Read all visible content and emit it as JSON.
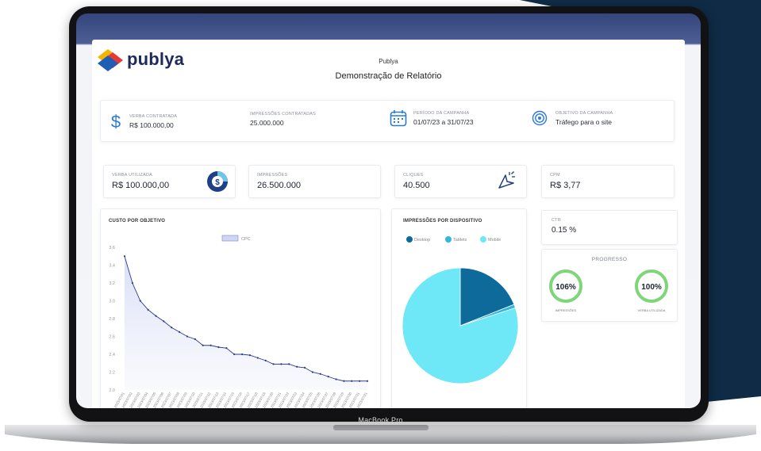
{
  "device": {
    "label": "MacBook Pro"
  },
  "header": {
    "brand": "publya",
    "company": "Publya",
    "report_title": "Demonstração de Relatório"
  },
  "summary": {
    "budget": {
      "label": "VERBA CONTRATADA",
      "value": "R$ 100.000,00",
      "icon": "dollar-icon"
    },
    "impressions": {
      "label": "IMPRESSÕES CONTRATADAS",
      "value": "25.000.000"
    },
    "period": {
      "label": "PERÍODO DA CAMPANHA",
      "value": "01/07/23 a 31/07/23",
      "icon": "calendar-icon"
    },
    "objective": {
      "label": "OBJETIVO DA CAMPANHA",
      "value": "Tráfego para o site",
      "icon": "target-icon"
    }
  },
  "metrics": {
    "spent": {
      "label": "VERBA UTILIZADA",
      "value": "R$ 100.000,00",
      "icon": "coin-icon"
    },
    "impressions": {
      "label": "IMPRESSÕES",
      "value": "26.500.000"
    },
    "clicks": {
      "label": "CLIQUES",
      "value": "40.500",
      "icon": "cursor-click-icon"
    },
    "cpm": {
      "label": "CPM",
      "value": "R$ 3,77"
    },
    "ctr": {
      "label": "CTR",
      "value": "0.15 %"
    }
  },
  "progress": {
    "title": "PROGRESSO",
    "items": [
      {
        "value": "106%",
        "label": "IMPRESSÕES",
        "fraction": 1.0
      },
      {
        "value": "100%",
        "label": "VERBA UTILIZADA",
        "fraction": 1.0
      }
    ],
    "color": "#7fd67a"
  },
  "colors": {
    "navy": "#0f2b46",
    "desktop": "#0d6a9b",
    "tablets": "#2fb8dd",
    "mobile": "#6ee7f7",
    "line": "#2e3a8c"
  },
  "chart_data": [
    {
      "type": "line",
      "title": "CUSTO POR OBJETIVO",
      "series": [
        {
          "name": "CPC",
          "values": [
            3.5,
            3.2,
            3.0,
            2.9,
            2.83,
            2.77,
            2.7,
            2.65,
            2.6,
            2.57,
            2.5,
            2.5,
            2.48,
            2.47,
            2.4,
            2.4,
            2.39,
            2.36,
            2.33,
            2.29,
            2.29,
            2.29,
            2.26,
            2.25,
            2.2,
            2.18,
            2.15,
            2.12,
            2.1,
            2.1,
            2.1,
            2.1
          ]
        }
      ],
      "x": [
        "2023/07/01",
        "2023/07/02",
        "2023/07/03",
        "2023/07/04",
        "2023/07/05",
        "2023/07/06",
        "2023/07/07",
        "2023/07/08",
        "2023/07/09",
        "2023/07/10",
        "2023/07/11",
        "2023/07/12",
        "2023/07/13",
        "2023/07/14",
        "2023/07/15",
        "2023/07/16",
        "2023/07/17",
        "2023/07/18",
        "2023/07/19",
        "2023/07/20",
        "2023/07/21",
        "2023/07/22",
        "2023/07/23",
        "2023/07/24",
        "2023/07/25",
        "2023/07/26",
        "2023/07/27",
        "2023/07/28",
        "2023/07/29",
        "2023/07/30",
        "2023/07/31",
        "2023/07/31"
      ],
      "y_ticks": [
        "3.6",
        "3.4",
        "3.2",
        "3.0",
        "2.8",
        "2.6",
        "2.4",
        "2.2",
        "2.0"
      ],
      "ylim": [
        2.0,
        3.6
      ],
      "legend": "top-center",
      "grid": false
    },
    {
      "type": "pie",
      "title": "IMPRESSÕES POR DISPOSITIVO",
      "legend": "top",
      "categories": [
        "Desktop",
        "Tablets",
        "Mobile"
      ],
      "values": [
        19,
        1,
        80
      ]
    }
  ]
}
